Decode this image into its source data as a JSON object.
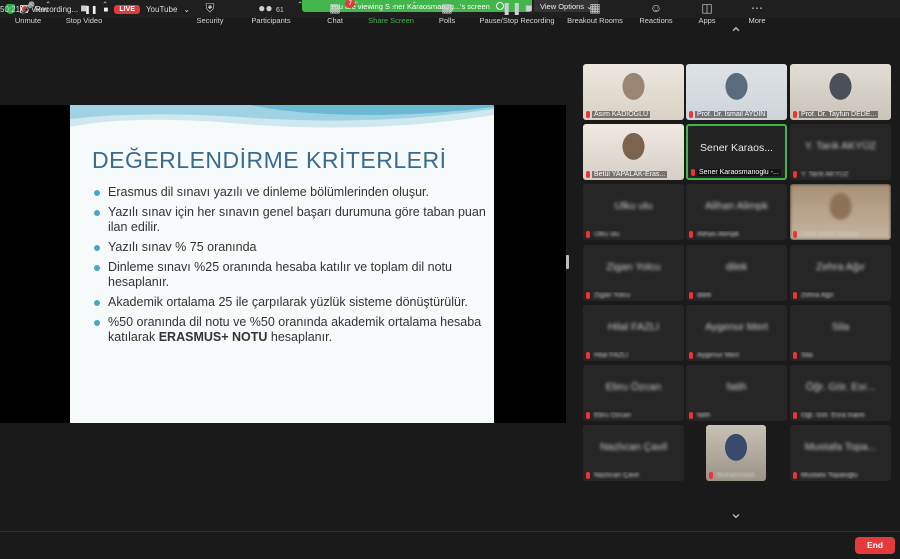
{
  "topbar": {
    "recording": "Recording...",
    "pause_icon": "pause-icon",
    "live": "LIVE",
    "youtube": "YouTube",
    "banner": "You are viewing Sener Karaosmanog...'s screen",
    "view_options": "View Options",
    "clock": "50:21",
    "view": "View"
  },
  "slide": {
    "title": "DEĞERLENDİRME KRİTERLERİ",
    "bullets": [
      "Erasmus dil sınavı yazılı ve dinleme bölümlerinden oluşur.",
      "Yazılı sınav için her sınavın genel başarı durumuna göre taban puan ilan edilir.",
      "Yazılı sınav % 75 oranında",
      "Dinleme sınavı %25 oranında hesaba katılır ve toplam dil notu hesaplanır.",
      "Akademik ortalama 25 ile çarpılarak yüzlük sisteme dönüştürülür."
    ],
    "last_bullet_pre": "%50 oranında dil notu ve %50 oranında akademik ortalama hesaba katılarak ",
    "last_bullet_bold": "ERASMUS+ NOTU",
    "last_bullet_post": " hesaplanır."
  },
  "gallery": {
    "tiles": [
      {
        "name": "Asım KADIOGLU",
        "center": ""
      },
      {
        "name": "Prof. Dr. İsmail AYDIN",
        "center": ""
      },
      {
        "name": "Prof. Dr. Tayfun DEDE...",
        "center": ""
      },
      {
        "name": "Betül YAPALAK-Eras...",
        "center": ""
      },
      {
        "name": "Sener Karaosmanoglu -...",
        "center": "Sener Karaos..."
      },
      {
        "name": "Y. Tarık AKYÜZ",
        "center": "Y. Tarık AKYÜZ"
      },
      {
        "name": "Ulku ulu",
        "center": "Ulku ulu"
      },
      {
        "name": "Alihan Alimpk",
        "center": "Alihan Alimpk"
      },
      {
        "name": "Dilek Kebil Akbulut",
        "center": ""
      },
      {
        "name": "Zigan Yolcu",
        "center": "Zigan Yolcu"
      },
      {
        "name": "dilek",
        "center": "dilek"
      },
      {
        "name": "Zehra Ağır",
        "center": "Zehra Ağır"
      },
      {
        "name": "Hilal FAZLI",
        "center": "Hilal FAZLI"
      },
      {
        "name": "Aygenur Mert",
        "center": "Aygenur Mert"
      },
      {
        "name": "Sila",
        "center": "Sila"
      },
      {
        "name": "Ebru Özcan",
        "center": "Ebru Özcan"
      },
      {
        "name": "fatih",
        "center": "fatih"
      },
      {
        "name": "Öğr. Gör. Esra Inanlı",
        "center": "Öğr. Gör. Esr..."
      },
      {
        "name": "Nazlıcan Çavil",
        "center": "Nazlıcan Çavil"
      },
      {
        "name": "Muhammed Emin T...",
        "center": ""
      },
      {
        "name": "Mustafa Topaloğlu",
        "center": "Mustafa Topa..."
      }
    ]
  },
  "toolbar": {
    "unmute": "Unmute",
    "stop_video": "Stop Video",
    "security": "Security",
    "participants": "Participants",
    "participants_count": "61",
    "chat": "Chat",
    "chat_badge": "7",
    "share_screen": "Share Screen",
    "polls": "Polls",
    "recording": "Pause/Stop Recording",
    "breakout": "Breakout Rooms",
    "reactions": "Reactions",
    "apps": "Apps",
    "more": "More",
    "end": "End"
  },
  "colors": {
    "accent_green": "#42b54b",
    "end_red": "#e23b3b",
    "slide_title": "#3a6b8f"
  }
}
